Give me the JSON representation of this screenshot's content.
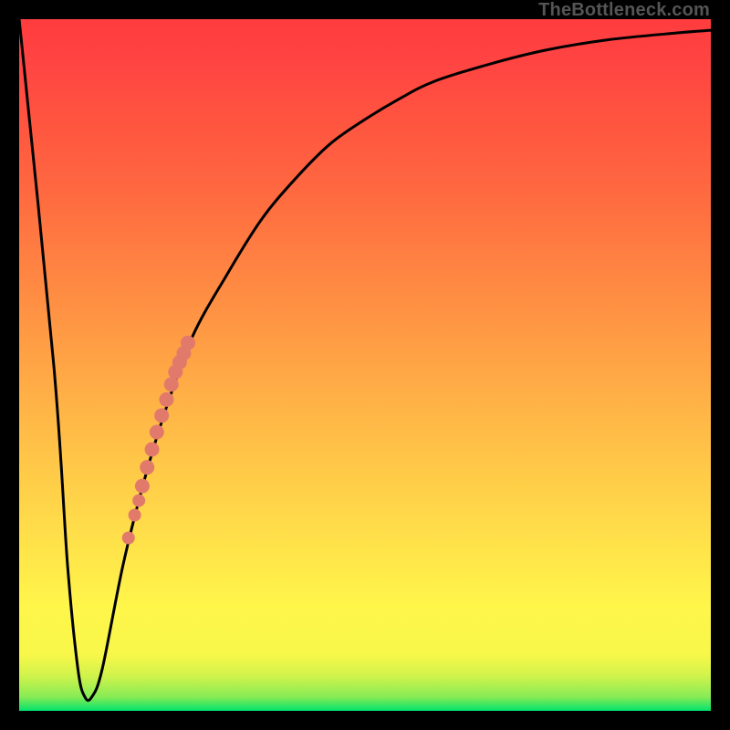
{
  "watermark": "TheBottleneck.com",
  "chart_data": {
    "type": "line",
    "title": "",
    "xlabel": "",
    "ylabel": "",
    "xlim": [
      0,
      100
    ],
    "ylim": [
      0,
      100
    ],
    "background_gradient": {
      "top_color": "#FF3C3E",
      "mid_color": "#FFF64A",
      "bottom_color": "#00E36C"
    },
    "series": [
      {
        "name": "bottleneck-curve",
        "type": "line",
        "color": "#000000",
        "x": [
          0,
          5,
          7,
          8.5,
          9.5,
          10.5,
          12,
          15,
          18,
          21,
          25,
          30,
          35,
          40,
          45,
          50,
          55,
          60,
          68,
          76,
          85,
          95,
          100
        ],
        "y": [
          100,
          50,
          21,
          6,
          2,
          2,
          6,
          21,
          33,
          43,
          54,
          63,
          71,
          77,
          82,
          85.5,
          88.5,
          91,
          93.5,
          95.5,
          97,
          98,
          98.4
        ]
      },
      {
        "name": "highlight-dots-upper",
        "type": "scatter",
        "color": "#E27A6C",
        "x": [
          17.8,
          18.5,
          19.2,
          19.9,
          20.6,
          21.3,
          22.0,
          22.6,
          23.2,
          23.8,
          24.4
        ],
        "y": [
          32.5,
          35.2,
          37.8,
          40.3,
          42.7,
          45.0,
          47.2,
          49.0,
          50.4,
          51.7,
          53.2
        ]
      },
      {
        "name": "highlight-dots-lower",
        "type": "scatter",
        "color": "#E27A6C",
        "x": [
          15.8,
          16.7,
          17.3
        ],
        "y": [
          25.0,
          28.3,
          30.4
        ]
      }
    ]
  }
}
